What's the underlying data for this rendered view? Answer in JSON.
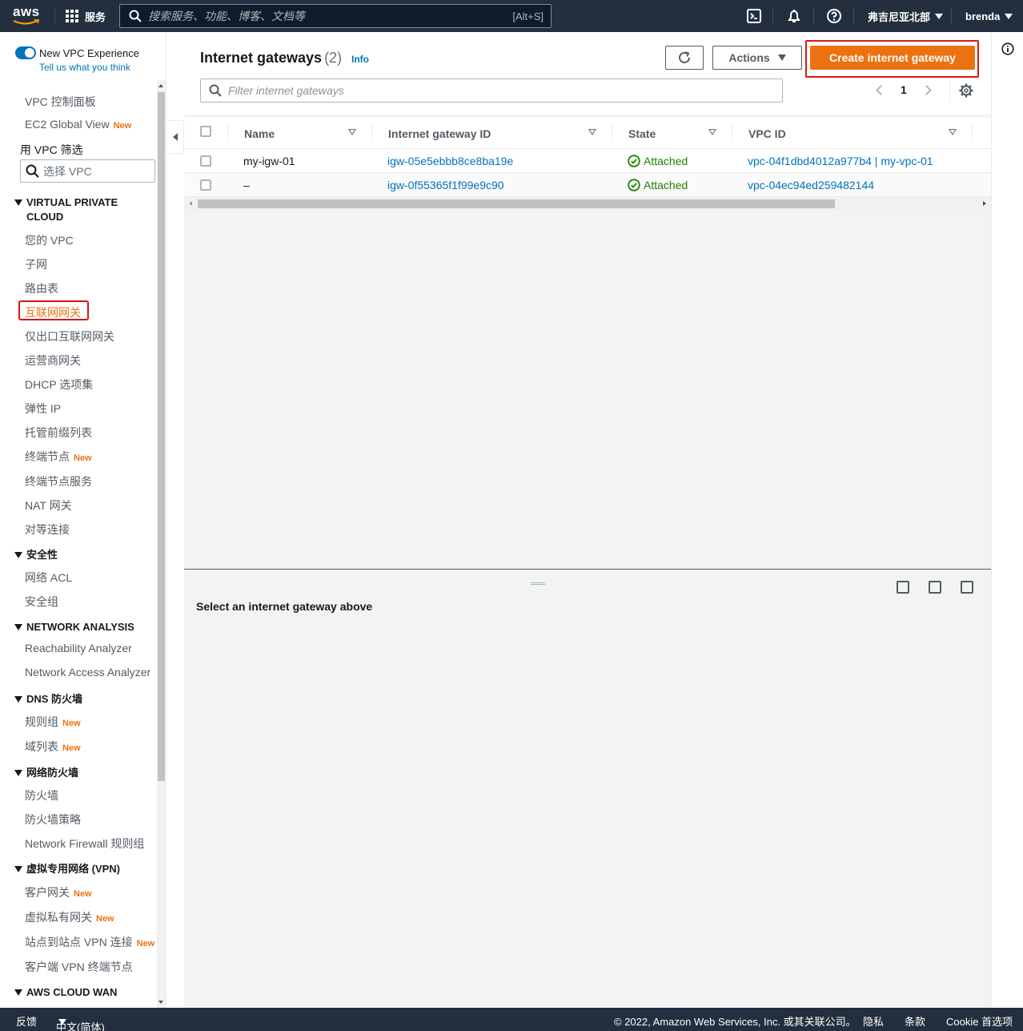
{
  "topnav": {
    "logo_text": "aws",
    "services_label": "服务",
    "search_placeholder": "搜索服务、功能、博客、文档等",
    "search_shortcut": "[Alt+S]",
    "region_label": "弗吉尼亚北部",
    "user_label": "brenda",
    "icons": [
      "cloudshell-icon",
      "notifications-icon",
      "help-icon"
    ]
  },
  "sidebar": {
    "experience_toggle_label": "New VPC Experience",
    "feedback_link": "Tell us what you think",
    "top_items": [
      {
        "label": "VPC 控制面板"
      },
      {
        "label": "EC2 Global View",
        "badge": "New"
      }
    ],
    "filter_label": "用 VPC 筛选",
    "filter_placeholder": "选择 VPC",
    "new_badge": "New",
    "sections": [
      {
        "title": "VIRTUAL PRIVATE CLOUD",
        "items": [
          "您的 VPC",
          "子网",
          "路由表",
          "互联网网关",
          "仅出口互联网网关",
          "运营商网关",
          "DHCP 选项集",
          "弹性 IP",
          "托管前缀列表",
          "终端节点",
          "终端节点服务",
          "NAT 网关",
          "对等连接"
        ]
      },
      {
        "title": "安全性",
        "items": [
          "网络 ACL",
          "安全组"
        ]
      },
      {
        "title": "NETWORK ANALYSIS",
        "items": [
          "Reachability Analyzer",
          "Network Access Analyzer"
        ]
      },
      {
        "title": "DNS 防火墙",
        "items": [
          "规则组",
          "域列表"
        ]
      },
      {
        "title": "网络防火墙",
        "items": [
          "防火墙",
          "防火墙策略",
          "Network Firewall 规则组"
        ]
      },
      {
        "title": "虚拟专用网络 (VPN)",
        "items": [
          "客户网关",
          "虚拟私有网关",
          "站点到站点 VPN 连接",
          "客户端 VPN 终端节点"
        ]
      },
      {
        "title": "AWS CLOUD WAN",
        "items": []
      }
    ],
    "active_item": "互联网网关"
  },
  "main": {
    "title": "Internet gateways",
    "count": "(2)",
    "info_link": "Info",
    "actions_label": "Actions",
    "create_label": "Create internet gateway",
    "filter_placeholder": "Filter internet gateways",
    "page_number": "1",
    "columns": [
      "Name",
      "Internet gateway ID",
      "State",
      "VPC ID"
    ],
    "rows": [
      {
        "name": "my-igw-01",
        "id": "igw-05e5ebbb8ce8ba19e",
        "state": "Attached",
        "vpc": "vpc-04f1dbd4012a977b4 | my-vpc-01"
      },
      {
        "name": "–",
        "id": "igw-0f55365f1f99e9c90",
        "state": "Attached",
        "vpc": "vpc-04ec94ed259482144"
      }
    ],
    "split_message": "Select an internet gateway above"
  },
  "footer": {
    "feedback": "反馈",
    "language": "中文(简体)",
    "copyright": "© 2022, Amazon Web Services, Inc. 或其关联公司。",
    "privacy": "隐私",
    "terms": "条款",
    "cookies": "Cookie 首选项"
  },
  "colors": {
    "nav_bg": "#232f3e",
    "accent_orange": "#ec7211",
    "link_blue": "#0073bb",
    "success_green": "#1d8102",
    "highlight_red": "#d91515"
  }
}
